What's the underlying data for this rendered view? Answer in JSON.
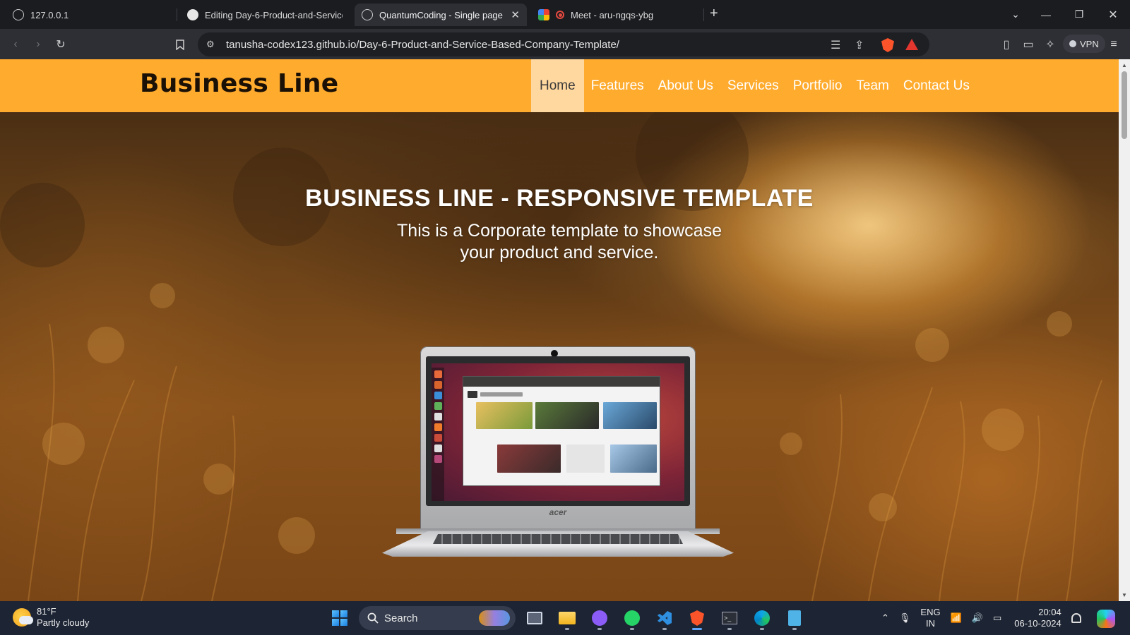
{
  "browser": {
    "tabs": [
      {
        "title": "127.0.0.1",
        "icon": "globe-icon",
        "active": false
      },
      {
        "title": "Editing Day-6-Product-and-Service",
        "icon": "github-icon",
        "active": false
      },
      {
        "title": "QuantumCoding - Single page",
        "icon": "globe-icon",
        "active": true
      },
      {
        "title": "Meet - aru-ngqs-ybg",
        "icon": "google-meet-icon",
        "active": false
      }
    ],
    "new_tab": "+",
    "address": "tanusha-codex123.github.io/Day-6-Product-and-Service-Based-Company-Template/",
    "vpn_label": "VPN"
  },
  "site": {
    "brand": "Business Line",
    "nav": [
      "Home",
      "Features",
      "About Us",
      "Services",
      "Portfolio",
      "Team",
      "Contact Us"
    ],
    "active_nav": "Home",
    "hero": {
      "title": "BUSINESS LINE - RESPONSIVE TEMPLATE",
      "subtitle": "This is a Corporate template to showcase your product and service."
    },
    "laptop_brand": "acer",
    "colors": {
      "navbar": "#ffab2e",
      "active_nav_bg": "#ffd8a0",
      "scroll_top_arrow": "#f08c00"
    }
  },
  "taskbar": {
    "weather_temp": "81°F",
    "weather_desc": "Partly cloudy",
    "search_label": "Search",
    "lang_line1": "ENG",
    "lang_line2": "IN",
    "time": "20:04",
    "date": "06-10-2024"
  }
}
